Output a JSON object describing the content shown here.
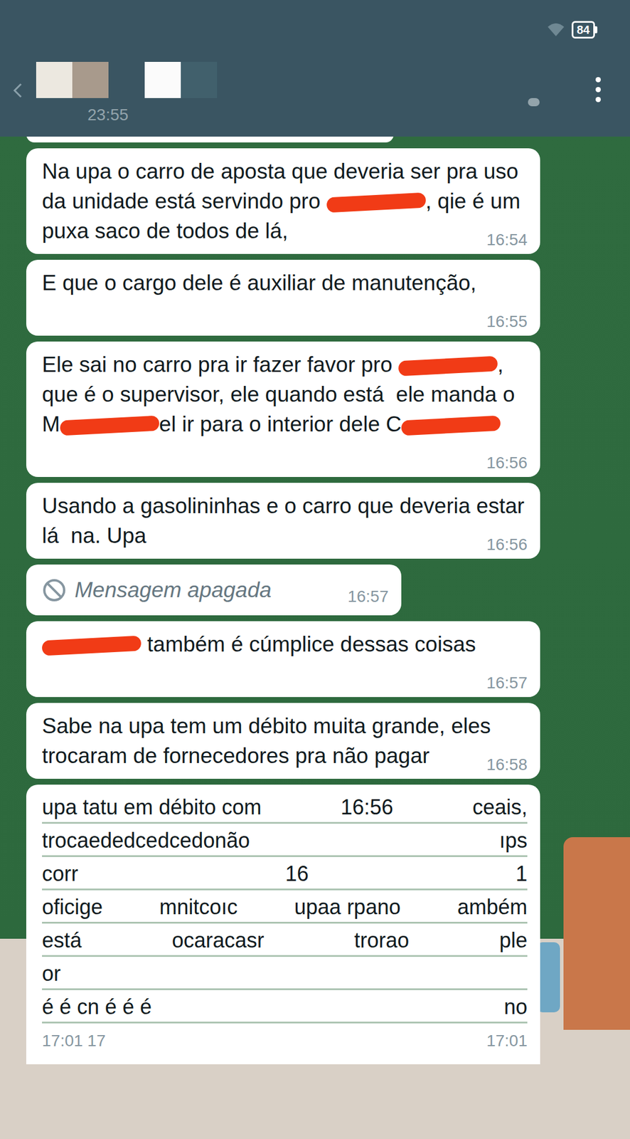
{
  "status_bar": {
    "battery": "84"
  },
  "header": {
    "subtitle": "23:55"
  },
  "messages": [
    {
      "kind": "text",
      "time": "16:54",
      "segments": [
        {
          "kind": "text",
          "text": "Na upa o carro de aposta que deveria ser pra uso da unidade está servindo pro "
        },
        {
          "kind": "redaction",
          "text": ""
        },
        {
          "kind": "text",
          "text": ", qie é um puxa saco de todos de lá,"
        }
      ]
    },
    {
      "kind": "text",
      "time": "16:55",
      "segments": [
        {
          "kind": "text",
          "text": "E que o cargo dele é auxiliar de manutenção,"
        }
      ]
    },
    {
      "kind": "text",
      "time": "16:56",
      "segments": [
        {
          "kind": "text",
          "text": "Ele sai no carro pra ir fazer favor pro "
        },
        {
          "kind": "redaction",
          "text": ""
        },
        {
          "kind": "text",
          "text": ", que é o supervisor, ele quando está  ele manda o M"
        },
        {
          "kind": "redaction",
          "text": ""
        },
        {
          "kind": "text",
          "text": "el ir para o interior dele C"
        },
        {
          "kind": "redaction",
          "text": ""
        }
      ]
    },
    {
      "kind": "text",
      "time": "16:56",
      "segments": [
        {
          "kind": "text",
          "text": "Usando a gasolininhas e o carro que deveria estar lá  na. Upa"
        }
      ]
    },
    {
      "kind": "deleted",
      "time": "16:57",
      "text": "Mensagem apagada"
    },
    {
      "kind": "text",
      "time": "16:57",
      "segments": [
        {
          "kind": "redaction",
          "text": ""
        },
        {
          "kind": "text",
          "text": " também é cúmplice dessas coisas"
        }
      ]
    },
    {
      "kind": "text",
      "time": "16:58",
      "segments": [
        {
          "kind": "text",
          "text": "Sabe na upa tem um débito muita grande, eles trocaram de fornecedores pra não pagar"
        }
      ]
    },
    {
      "kind": "glitch",
      "lines": [
        [
          "upa tatu em débito com",
          "16:56",
          "ceais,"
        ],
        [
          "trocaededcedcedonão",
          "ıps"
        ],
        [
          "corr",
          "16",
          "1"
        ],
        [
          "oficige",
          "mnitcoıc",
          "upaa rpano",
          "ambém"
        ],
        [
          "está",
          "ocaracasr",
          "trorao",
          "ple"
        ],
        [
          "or"
        ],
        [
          "é é cn é é é",
          "no"
        ]
      ],
      "footer": [
        "17:01 17",
        "17:01"
      ]
    }
  ]
}
